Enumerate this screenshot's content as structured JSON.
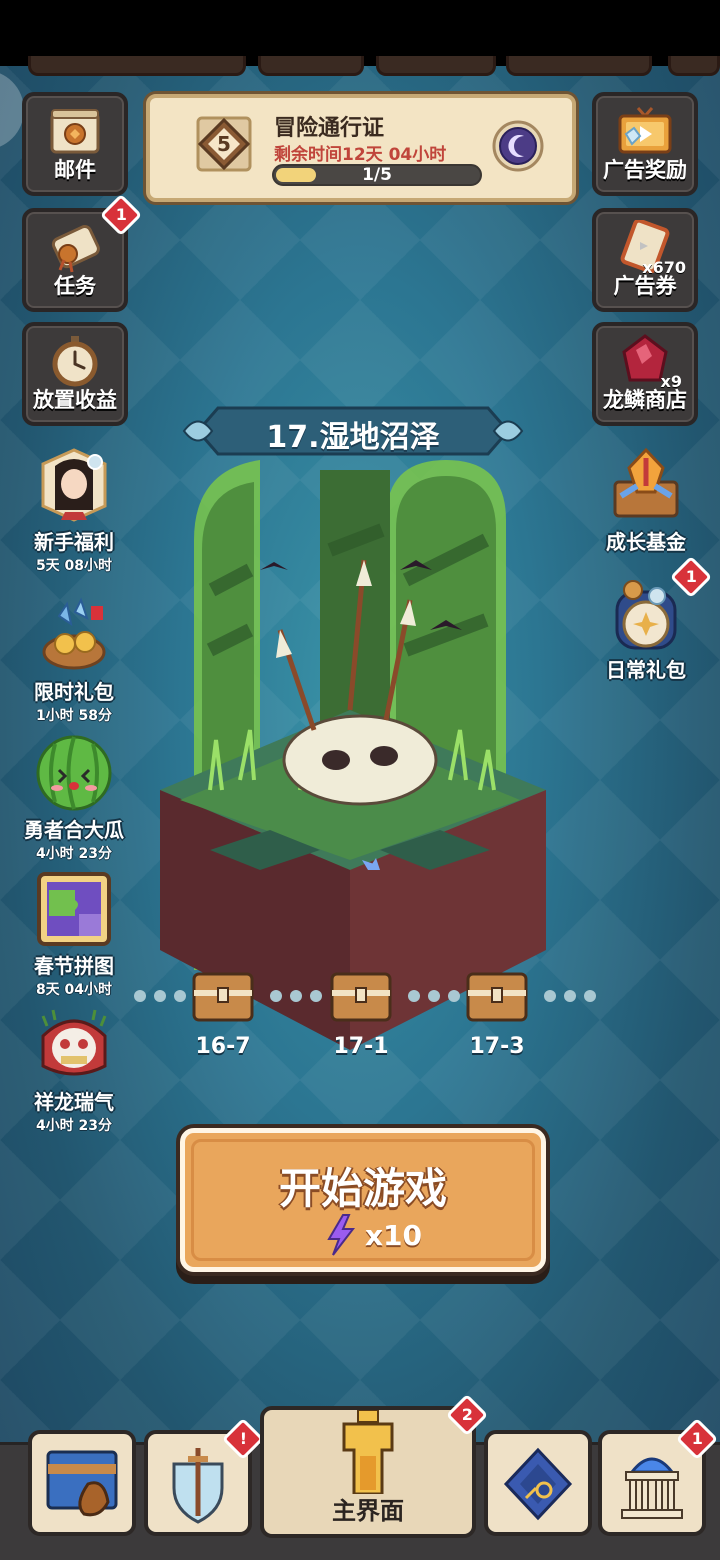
{
  "left_buttons": [
    {
      "label": "邮件",
      "icon": "mail-scroll-icon"
    },
    {
      "label": "任务",
      "icon": "quest-scroll-icon",
      "badge": "1"
    },
    {
      "label": "放置收益",
      "icon": "stopwatch-icon"
    }
  ],
  "right_buttons": [
    {
      "label": "广告奖励",
      "icon": "ad-tv-icon"
    },
    {
      "label": "广告券",
      "icon": "ad-ticket-icon",
      "count": "x670"
    },
    {
      "label": "龙鳞商店",
      "icon": "dragon-scale-icon",
      "count": "x9"
    }
  ],
  "pass": {
    "level": "5",
    "title": "冒险通行证",
    "remaining": "剩余时间12天 04小时",
    "progress_text": "1/5",
    "progress_fraction": 0.2
  },
  "left_events": [
    {
      "name": "新手福利",
      "time": "5天 08小时",
      "icon": "heroine-portrait-icon"
    },
    {
      "name": "限时礼包",
      "time": "1小时 58分",
      "icon": "treasure-pile-icon"
    },
    {
      "name": "勇者合大瓜",
      "time": "4小时 23分",
      "icon": "watermelon-icon"
    },
    {
      "name": "春节拼图",
      "time": "8天 04小时",
      "icon": "puzzle-icon"
    },
    {
      "name": "祥龙瑞气",
      "time": "4小时 23分",
      "icon": "lion-mask-icon"
    }
  ],
  "right_events": [
    {
      "name": "成长基金",
      "icon": "growth-fund-chest-icon"
    },
    {
      "name": "日常礼包",
      "icon": "daily-gift-jar-icon",
      "badge": "1"
    }
  ],
  "stage": {
    "title": "17.湿地沼泽"
  },
  "checkpoints": [
    {
      "label": "16-7"
    },
    {
      "label": "17-1"
    },
    {
      "label": "17-3"
    }
  ],
  "start_button": {
    "label": "开始游戏",
    "cost": "x10"
  },
  "bottom_nav": [
    {
      "icon": "map-bag-icon"
    },
    {
      "icon": "sword-shield-icon",
      "badge": "!"
    },
    {
      "label": "主界面",
      "icon": "knight-armor-icon",
      "badge": "2"
    },
    {
      "icon": "dice-tiles-icon"
    },
    {
      "icon": "temple-icon",
      "badge": "1"
    }
  ],
  "colors": {
    "background": "#2c7692",
    "start_button": "#e9a65c",
    "badge": "#d8323a",
    "pass_card": "#f3e4c4",
    "remaining_text": "#c0453b"
  }
}
